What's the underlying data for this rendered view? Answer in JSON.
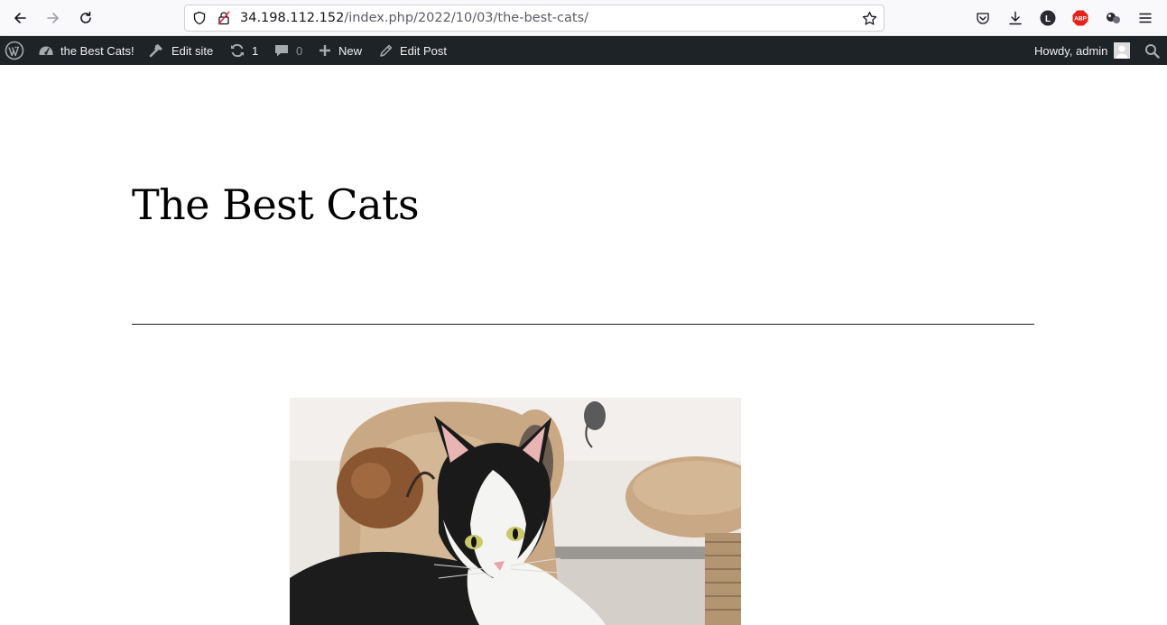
{
  "browser": {
    "url_host": "34.198.112.152",
    "url_path": "/index.php/2022/10/03/the-best-cats/"
  },
  "adminbar": {
    "site_name": "the Best Cats!",
    "edit_site": "Edit site",
    "updates_count": "1",
    "comments_count": "0",
    "new_label": "New",
    "edit_post": "Edit Post",
    "howdy": "Howdy, admin"
  },
  "post": {
    "title": "The Best Cats"
  },
  "colors": {
    "adminbar_bg": "#1d2327",
    "browser_bg": "#f9f9fb",
    "abp_red": "#e2231a"
  }
}
